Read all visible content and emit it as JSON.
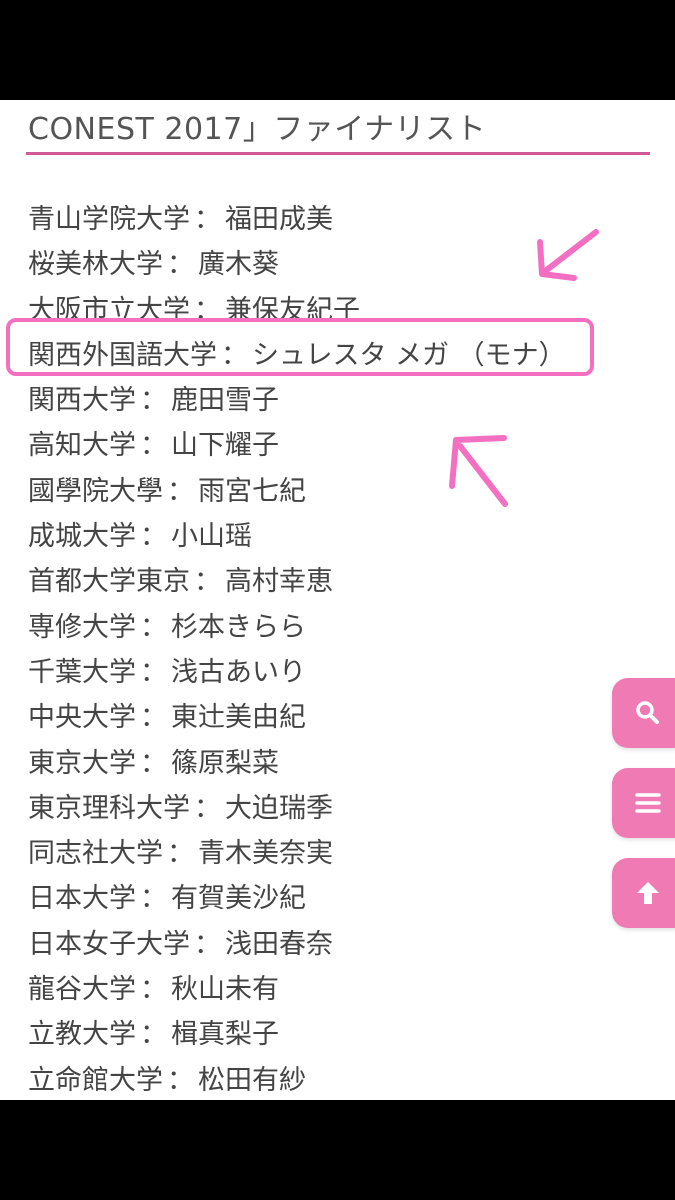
{
  "page": {
    "heading": "CONEST 2017」ファイナリスト"
  },
  "separator": "：",
  "finalists": [
    {
      "university": "青山学院大学",
      "name": "福田成美"
    },
    {
      "university": "桜美林大学",
      "name": "廣木葵"
    },
    {
      "university": "大阪市立大学",
      "name": "兼保友紀子"
    },
    {
      "university": "関西外国語大学",
      "name": "シュレスタ メガ （モナ）"
    },
    {
      "university": "関西大学",
      "name": "鹿田雪子"
    },
    {
      "university": "高知大学",
      "name": "山下耀子"
    },
    {
      "university": "國學院大學",
      "name": "雨宮七紀"
    },
    {
      "university": "成城大学",
      "name": "小山瑶"
    },
    {
      "university": "首都大学東京",
      "name": "高村幸恵"
    },
    {
      "university": "専修大学",
      "name": "杉本きらら"
    },
    {
      "university": "千葉大学",
      "name": "浅古あいり"
    },
    {
      "university": "中央大学",
      "name": "東辻美由紀"
    },
    {
      "university": "東京大学",
      "name": "篠原梨菜"
    },
    {
      "university": "東京理科大学",
      "name": "大迫瑞季"
    },
    {
      "university": "同志社大学",
      "name": "青木美奈実"
    },
    {
      "university": "日本大学",
      "name": "有賀美沙紀"
    },
    {
      "university": "日本女子大学",
      "name": "浅田春奈"
    },
    {
      "university": "龍谷大学",
      "name": "秋山未有"
    },
    {
      "university": "立教大学",
      "name": "楫真梨子"
    },
    {
      "university": "立命館大学",
      "name": "松田有紗"
    }
  ],
  "annotation": {
    "highlighted_row": 3,
    "color": "#f36fc1"
  },
  "fab_buttons": [
    {
      "icon": "search-icon"
    },
    {
      "icon": "menu-icon"
    },
    {
      "icon": "arrow-up-icon"
    }
  ],
  "colors": {
    "accent": "#d05a98",
    "fab": "#f07ab4",
    "text": "#444444"
  }
}
